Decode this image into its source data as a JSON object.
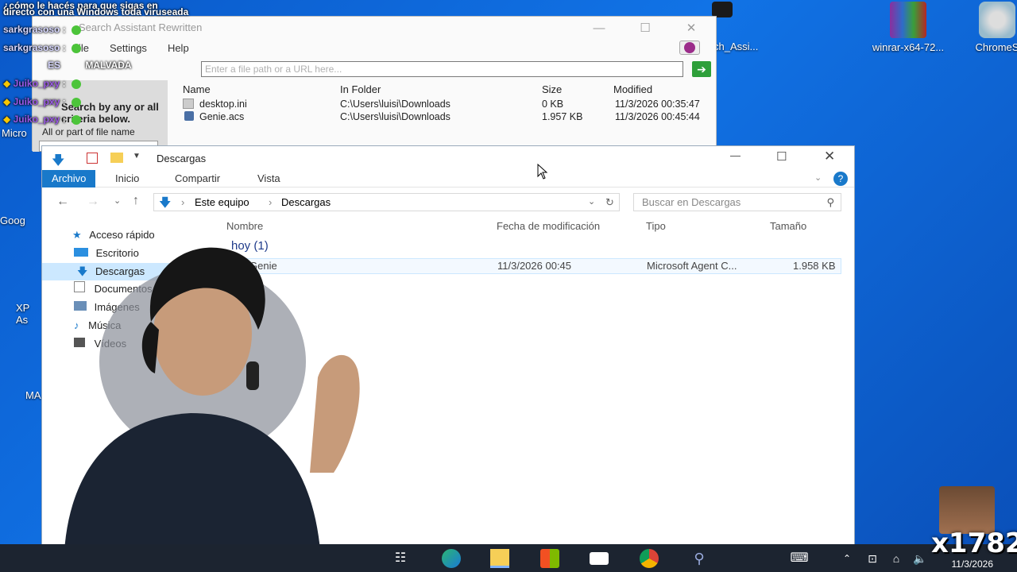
{
  "chat": [
    {
      "name": "",
      "text": "¿cómo le hacés para que sigas en"
    },
    {
      "name": "",
      "text": "directo con una Windows toda viruseada"
    },
    {
      "name": "sarkgrasoso",
      "text": ":"
    },
    {
      "name": "sarkgrasoso",
      "text": ":"
    },
    {
      "name": "ES",
      "text": "MALVADA"
    },
    {
      "name": "Juiko_pxy",
      "text": ":"
    },
    {
      "name": "Juiko_pxy",
      "text": ":"
    },
    {
      "name": "Juiko_pxy",
      "text": ":"
    }
  ],
  "search_assistant": {
    "title": "Search Assistant Rewritten",
    "menu": [
      "File",
      "Settings",
      "Help"
    ],
    "address_placeholder": "Enter a file path or a URL here...",
    "sidebar_heading": "Search by any or all criteria below.",
    "sidebar_label": "All or part of file name",
    "columns": [
      "Name",
      "In Folder",
      "Size",
      "Modified"
    ],
    "rows": [
      {
        "name": "desktop.ini",
        "folder": "C:\\Users\\luisi\\Downloads",
        "size": "0 KB",
        "modified": "11/3/2026 00:35:47"
      },
      {
        "name": "Genie.acs",
        "folder": "C:\\Users\\luisi\\Downloads",
        "size": "1.957 KB",
        "modified": "11/3/2026 00:45:44"
      }
    ]
  },
  "explorer": {
    "title": "Descargas",
    "tabs": [
      "Archivo",
      "Inicio",
      "Compartir",
      "Vista"
    ],
    "breadcrumb": [
      "Este equipo",
      "Descargas"
    ],
    "search_placeholder": "Buscar en Descargas",
    "columns": [
      "Nombre",
      "Fecha de modificación",
      "Tipo",
      "Tamaño"
    ],
    "sidebar": [
      "Acceso rápido",
      "Escritorio",
      "Descargas",
      "Documentos",
      "Imágenes",
      "Música",
      "Vídeos"
    ],
    "group": "hoy (1)",
    "file": {
      "name": "Genie",
      "date": "11/3/2026 00:45",
      "type": "Microsoft Agent C...",
      "size": "1.958 KB"
    }
  },
  "desktop_icons": [
    "winrar-x64-72...",
    "ChromeS",
    "ch_Assi..."
  ],
  "desktop_partial": [
    "Micro",
    "Goog",
    "XP As",
    "MA"
  ],
  "taskbar": {
    "date": "11/3/2026"
  },
  "overlay_badge": "x1782",
  "colors": {
    "accent": "#1979ca",
    "desktop": "#0a58c8",
    "taskbar": "#1c2430"
  }
}
